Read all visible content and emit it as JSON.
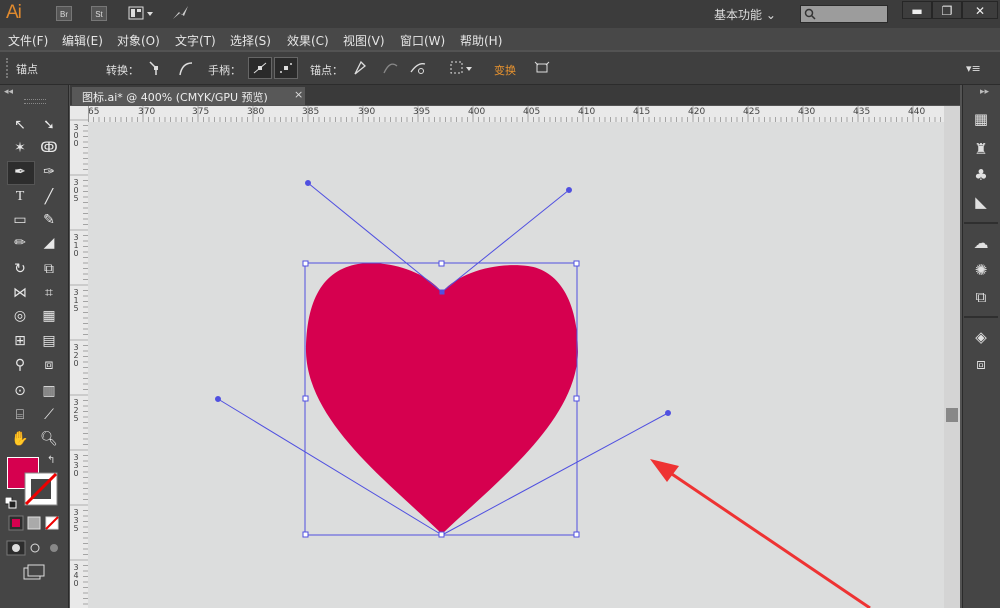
{
  "app": {
    "logo": "Ai",
    "icons": [
      "bridge-icon",
      "stock-icon",
      "arrange-documents-icon",
      "gpu-performance-icon"
    ],
    "stock_label": "St",
    "bridge_label": "Br",
    "workspace": "基本功能",
    "window_controls": [
      "minimize",
      "restore",
      "close"
    ]
  },
  "menu": [
    "文件(F)",
    "编辑(E)",
    "对象(O)",
    "文字(T)",
    "选择(S)",
    "效果(C)",
    "视图(V)",
    "窗口(W)",
    "帮助(H)"
  ],
  "control_bar": {
    "anchor_label": "锚点",
    "convert_label": "转换：",
    "handles_label": "手柄：",
    "anchors_label": "锚点：",
    "transform_label": "变换"
  },
  "document_tab": {
    "title": "图标.ai* @ 400% (CMYK/GPU 预览)",
    "close": "×"
  },
  "ruler_top": [
    "65",
    "370",
    "375",
    "380",
    "385",
    "390",
    "395",
    "400",
    "405",
    "410",
    "415",
    "420",
    "425",
    "430",
    "435",
    "440"
  ],
  "ruler_left": [
    "300",
    "305",
    "310",
    "315",
    "320",
    "325",
    "330",
    "335",
    "340"
  ],
  "colors": {
    "fill": "#d6004f",
    "path_blue": "#5050e0",
    "arrow_red": "#ee3333",
    "accent_orange": "#e8932f"
  }
}
